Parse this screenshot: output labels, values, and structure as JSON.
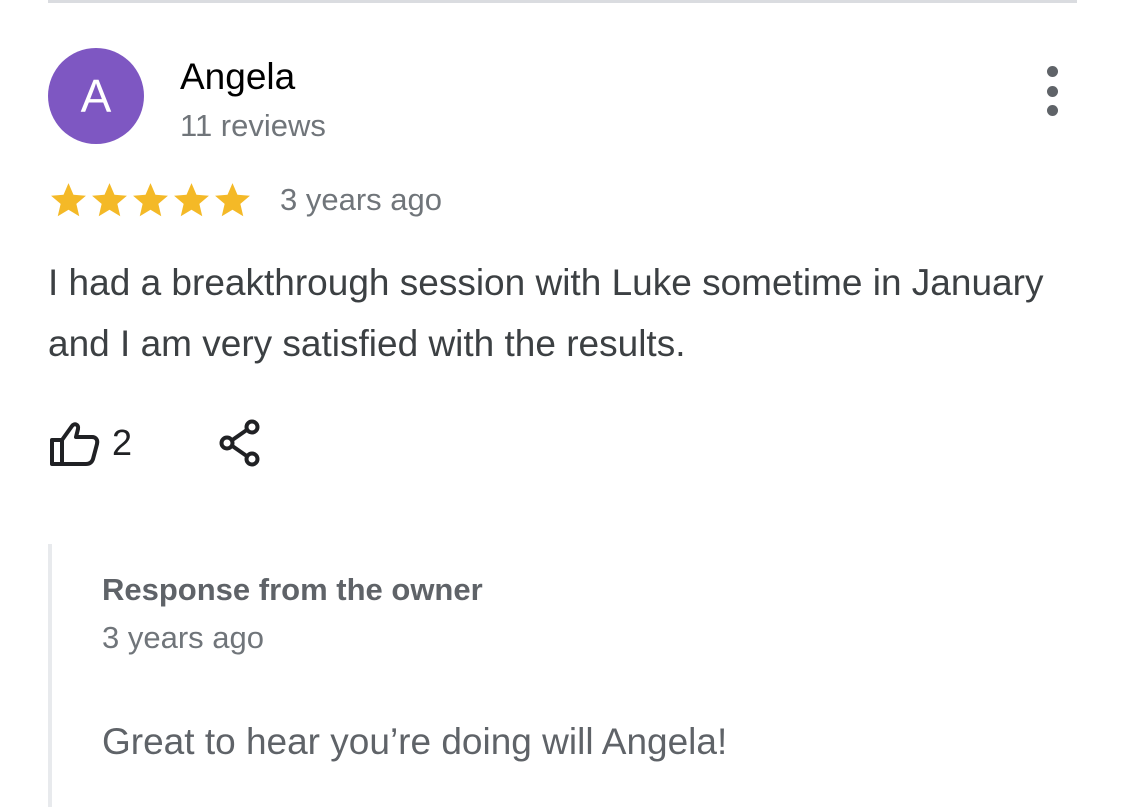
{
  "review": {
    "author": {
      "initial": "A",
      "name": "Angela",
      "meta": "11 reviews",
      "avatar_color": "#7e57c2"
    },
    "rating": 5,
    "max_rating": 5,
    "star_color": "#f4b927",
    "time": "3 years ago",
    "text": "I had a breakthrough session with Luke sometime in January and I am very satisfied with the results.",
    "likes": "2",
    "icons": {
      "more": "more-vertical-icon",
      "like": "thumb-up-outline-icon",
      "share": "share-icon"
    }
  },
  "owner_response": {
    "title": "Response from the owner",
    "time": "3 years ago",
    "text": "Great to hear you’re doing will Angela!"
  }
}
